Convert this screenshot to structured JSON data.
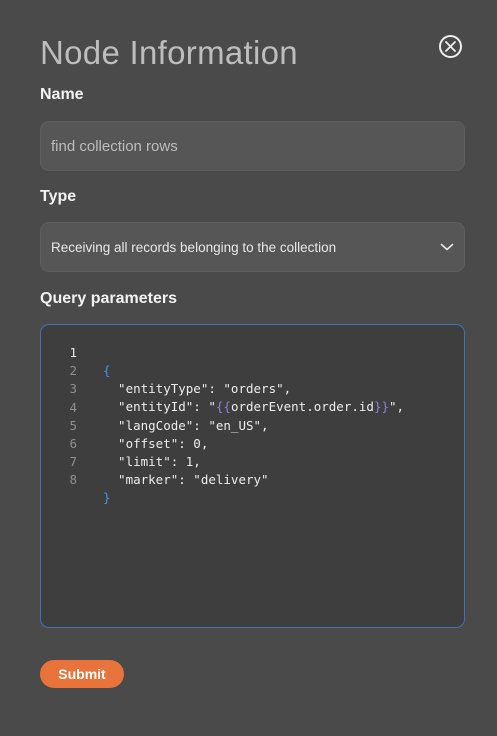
{
  "dialog": {
    "title": "Node Information",
    "close_icon": "close-circle-icon"
  },
  "name_field": {
    "label": "Name",
    "placeholder": "find collection rows",
    "value": ""
  },
  "type_field": {
    "label": "Type",
    "selected": "Receiving all records belonging to the collection",
    "icon": "chevron-down-icon"
  },
  "query": {
    "label": "Query parameters",
    "active_line": 1,
    "lines": [
      {
        "num": "1",
        "text": "{"
      },
      {
        "num": "2",
        "text": "  \"entityType\": \"orders\","
      },
      {
        "num": "3",
        "text": "  \"entityId\": \"{{orderEvent.order.id}}\","
      },
      {
        "num": "4",
        "text": "  \"langCode\": \"en_US\","
      },
      {
        "num": "5",
        "text": "  \"offset\": 0,"
      },
      {
        "num": "6",
        "text": "  \"limit\": 1,"
      },
      {
        "num": "7",
        "text": "  \"marker\": \"delivery\""
      },
      {
        "num": "8",
        "text": "}"
      }
    ],
    "line3_parts": {
      "pre": "  \"entityId\": \"",
      "open": "{{",
      "expr": "orderEvent.order.id",
      "close": "}}",
      "post": "\","
    }
  },
  "submit": {
    "label": "Submit",
    "color": "#e8743b"
  },
  "colors": {
    "background": "#4b4a4a",
    "field_bg": "#575656",
    "editor_bg": "#3f3e3e",
    "editor_border": "#3f73b8",
    "brace": "#4a90e2"
  }
}
